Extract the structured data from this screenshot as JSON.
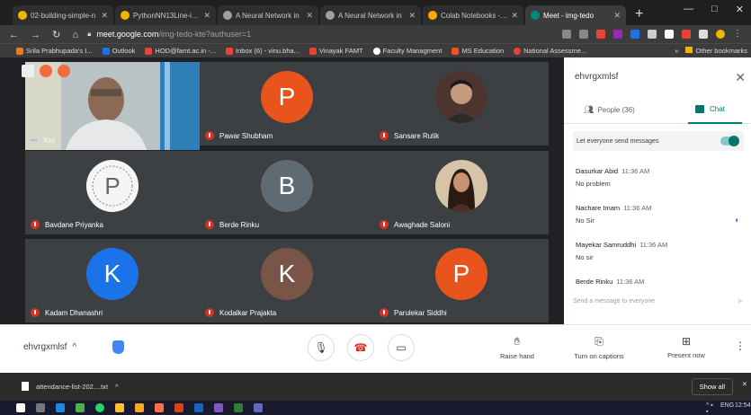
{
  "browser": {
    "tabs": [
      {
        "title": "02-building-simple-n",
        "active": false,
        "color": "#f2b600"
      },
      {
        "title": "PythonNN13Line-iam",
        "active": false,
        "color": "#f2b600"
      },
      {
        "title": "A Neural Network in",
        "active": false,
        "color": "#9aa0a6"
      },
      {
        "title": "A Neural Network in",
        "active": false,
        "color": "#9aa0a6"
      },
      {
        "title": "Colab Notebooks - G",
        "active": false,
        "color": "#f9ab00"
      },
      {
        "title": "Meet - img-tedo",
        "active": true,
        "color": "#00897b"
      }
    ],
    "url_host": "meet.google.com",
    "url_path": "/img-tedo-kte?authuser=1",
    "bookmarks": [
      {
        "label": "Srila Prabhupada's I...",
        "color": "#e67c22"
      },
      {
        "label": "Outlook",
        "color": "#1a73e8"
      },
      {
        "label": "HOD@famt.ac.in -...",
        "color": "#ea4335"
      },
      {
        "label": "Inbox (6) - vinu.bha...",
        "color": "#ea4335"
      },
      {
        "label": "Vinayak FAMT",
        "color": "#ea4335"
      },
      {
        "label": "Faculty Managment",
        "color": "#ffffff"
      },
      {
        "label": "MS Education",
        "color": "#f25022"
      },
      {
        "label": "National Assessme...",
        "color": "#ea4335"
      }
    ],
    "bookmarks_other": "Other bookmarks"
  },
  "meet": {
    "participants": [
      {
        "name": "You",
        "initial": "",
        "color": "",
        "self": true
      },
      {
        "name": "Pawar Shubham",
        "initial": "P",
        "color": "#e8541c"
      },
      {
        "name": "Sansare Rutik",
        "initial": "",
        "color": "#5d4037",
        "photo": true
      },
      {
        "name": "Bavdane Priyanka",
        "initial": "P",
        "color": "#f5f5f5",
        "photo": true
      },
      {
        "name": "Berde Rinku",
        "initial": "B",
        "color": "#5f6b73"
      },
      {
        "name": "Awaghade Saloni",
        "initial": "",
        "color": "#8d6e63",
        "photo": true
      },
      {
        "name": "Kadam Dhanashri",
        "initial": "K",
        "color": "#1a73e8"
      },
      {
        "name": "Kodalkar Prajakta",
        "initial": "K",
        "color": "#795548"
      },
      {
        "name": "Parulekar Siddhi",
        "initial": "P",
        "color": "#e8541c"
      }
    ],
    "meeting_code": "ehvrgxmlsf",
    "controls": {
      "raise_hand": "Raise hand",
      "captions": "Turn on captions",
      "present": "Present now"
    }
  },
  "panel": {
    "title": "ehvrgxmlsf",
    "people_tab": "People (36)",
    "chat_tab": "Chat",
    "send_setting": "Let everyone send messages",
    "messages": [
      {
        "sender": "Dasurkar Abid",
        "time": "11:36 AM",
        "text": "No problem"
      },
      {
        "sender": "Nachare Imam",
        "time": "11:36 AM",
        "text": "No Sir"
      },
      {
        "sender": "Mayekar Samruddhi",
        "time": "11:36 AM",
        "text": "No sir"
      },
      {
        "sender": "Berde Rinku",
        "time": "11:36 AM",
        "text": ""
      }
    ],
    "input_placeholder": "Send a message to everyone"
  },
  "downloads": {
    "file": "attendance-list-202....txt",
    "show_all": "Show all"
  },
  "taskbar": {
    "time": "12:54"
  }
}
